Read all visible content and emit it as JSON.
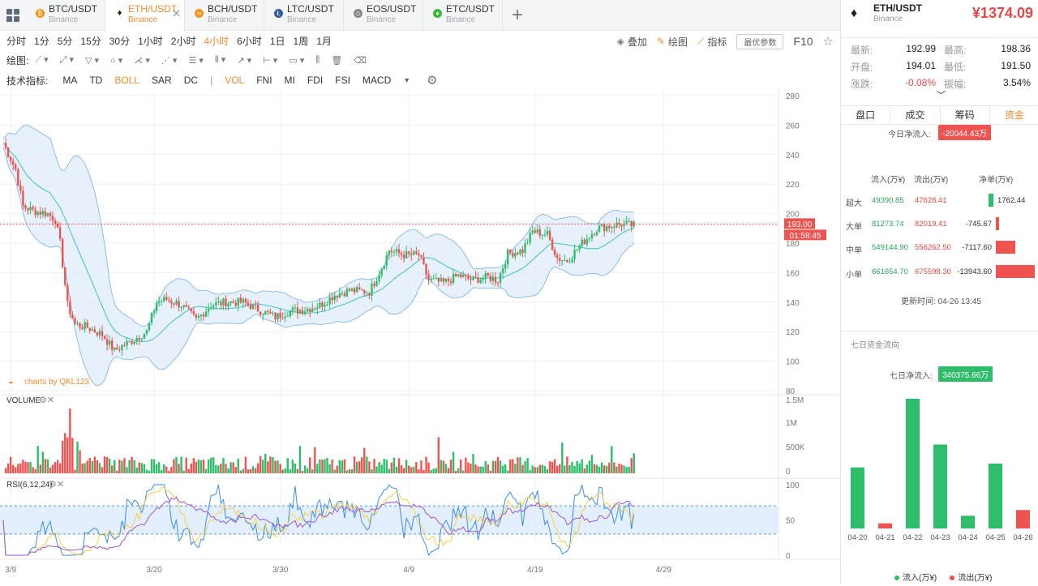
{
  "tabs": [
    {
      "pair": "BTC/USDT",
      "exchange": "Binance",
      "color": "#f7931a",
      "glyph": "₿"
    },
    {
      "pair": "ETH/USDT",
      "exchange": "Binance",
      "color": "#222222",
      "glyph": "♦",
      "active": true
    },
    {
      "pair": "BCH/USDT",
      "exchange": "Binance",
      "color": "#f7931a",
      "glyph": "∞"
    },
    {
      "pair": "LTC/USDT",
      "exchange": "Binance",
      "color": "#345d9d",
      "glyph": "Ł"
    },
    {
      "pair": "EOS/USDT",
      "exchange": "Binance",
      "color": "#888888",
      "glyph": "◇"
    },
    {
      "pair": "ETC/USDT",
      "exchange": "Binance",
      "color": "#3ab83a",
      "glyph": "♦"
    }
  ],
  "timeframes": [
    "分时",
    "1分",
    "5分",
    "15分",
    "30分",
    "1小时",
    "2小时",
    "4小时",
    "6小时",
    "1日",
    "1周",
    "1月"
  ],
  "active_timeframe": "4小时",
  "toolbar": {
    "overlay": "叠加",
    "draw": "绘图",
    "indicator": "指标",
    "pref": "最优参数",
    "f10": "F10"
  },
  "drawbar_label": "绘图:",
  "indicator_label": "技术指标:",
  "indicators_main": [
    "MA",
    "TD",
    "BOLL",
    "SAR",
    "DC"
  ],
  "indicators_sub": [
    "VOL",
    "FNI",
    "MI",
    "FDI",
    "FSI",
    "MACD"
  ],
  "indicators_on": [
    "BOLL",
    "VOL"
  ],
  "symbol": {
    "pair": "ETH/USDT",
    "exchange": "Binance",
    "price": "¥1374.09"
  },
  "stats": {
    "latest_l": "最新:",
    "latest": "192.99",
    "high_l": "最高:",
    "high": "198.36",
    "open_l": "开盘:",
    "open": "194.01",
    "low_l": "最低:",
    "low": "191.50",
    "change_l": "涨跌:",
    "change": "-0.08%",
    "amp_l": "振幅:",
    "amp": "3.54%"
  },
  "panel_tabs": [
    "盘口",
    "成交",
    "筹码",
    "资金"
  ],
  "active_panel_tab": "资金",
  "today": {
    "label": "今日净流入:",
    "value": "-20044.43万"
  },
  "flow_headers": {
    "in": "流入(万¥)",
    "out": "流出(万¥)",
    "net": "净单(万¥)"
  },
  "flows": [
    {
      "label": "超大",
      "in": "49390.85",
      "out": "47628.41",
      "net": "1762.44",
      "net_value": 1762.44
    },
    {
      "label": "大单",
      "in": "81273.74",
      "out": "82019.41",
      "net": "-745.67",
      "net_value": -745.67
    },
    {
      "label": "中单",
      "in": "549144.90",
      "out": "556262.50",
      "net": "-7117.60",
      "net_value": -7117.6
    },
    {
      "label": "小单",
      "in": "661654.70",
      "out": "675598.30",
      "net": "-13943.60",
      "net_value": -13943.6
    }
  ],
  "update_time": "更新时间: 04-26 13:45",
  "seven_day": {
    "title": "七日资金流向",
    "label": "七日净流入:",
    "value": "340375.66万"
  },
  "seven_chart": {
    "type": "bar",
    "categories": [
      "04-20",
      "04-21",
      "04-22",
      "04-23",
      "04-24",
      "04-25",
      "04-26"
    ],
    "values": [
      48000,
      4000,
      102000,
      66000,
      10000,
      51000,
      14500
    ],
    "colors": [
      "green",
      "red",
      "green",
      "green",
      "green",
      "green",
      "red"
    ],
    "legend": [
      "流入(万¥)",
      "流出(万¥)"
    ]
  },
  "colors": {
    "up": "#2ebd6b",
    "down": "#ef5350",
    "accent": "#f28b2f"
  },
  "chart_data": {
    "type": "candlestick",
    "price_ticks": [
      "280",
      "260",
      "240",
      "220",
      "200",
      "180",
      "160",
      "140",
      "120",
      "100",
      "80"
    ],
    "price_range": [
      80,
      280
    ],
    "current_price_label": "193.00",
    "countdown_label": "01:58:45",
    "volume_label": "VOLUME",
    "volume_ticks": [
      "1.5M",
      "1M",
      "500K",
      "0"
    ],
    "volume_range": [
      0,
      1500000
    ],
    "rsi_label": "RSI(6,12,24)",
    "rsi_ticks": [
      "100",
      "50",
      "0"
    ],
    "rsi_bands": [
      70,
      30
    ],
    "x_ticks": [
      {
        "label": "3/9",
        "index": 3
      },
      {
        "label": "3/20",
        "index": 61
      },
      {
        "label": "3/30",
        "index": 112
      },
      {
        "label": "4/9",
        "index": 164
      },
      {
        "label": "4/19",
        "index": 215
      },
      {
        "label": "4/29",
        "index": 267
      }
    ],
    "closes": [
      {
        "i": 0,
        "v": 248
      },
      {
        "i": 5,
        "v": 230
      },
      {
        "i": 8,
        "v": 205
      },
      {
        "i": 12,
        "v": 202
      },
      {
        "i": 18,
        "v": 200
      },
      {
        "i": 21,
        "v": 196
      },
      {
        "i": 23,
        "v": 180
      },
      {
        "i": 26,
        "v": 138
      },
      {
        "i": 29,
        "v": 125
      },
      {
        "i": 34,
        "v": 123
      },
      {
        "i": 40,
        "v": 118
      },
      {
        "i": 45,
        "v": 107
      },
      {
        "i": 52,
        "v": 114
      },
      {
        "i": 58,
        "v": 120
      },
      {
        "i": 62,
        "v": 140
      },
      {
        "i": 66,
        "v": 142
      },
      {
        "i": 72,
        "v": 138
      },
      {
        "i": 78,
        "v": 128
      },
      {
        "i": 84,
        "v": 138
      },
      {
        "i": 90,
        "v": 140
      },
      {
        "i": 97,
        "v": 140
      },
      {
        "i": 103,
        "v": 135
      },
      {
        "i": 110,
        "v": 130
      },
      {
        "i": 116,
        "v": 134
      },
      {
        "i": 122,
        "v": 135
      },
      {
        "i": 128,
        "v": 138
      },
      {
        "i": 134,
        "v": 145
      },
      {
        "i": 140,
        "v": 148
      },
      {
        "i": 148,
        "v": 147
      },
      {
        "i": 152,
        "v": 160
      },
      {
        "i": 156,
        "v": 175
      },
      {
        "i": 162,
        "v": 172
      },
      {
        "i": 168,
        "v": 172
      },
      {
        "i": 172,
        "v": 155
      },
      {
        "i": 178,
        "v": 153
      },
      {
        "i": 184,
        "v": 158
      },
      {
        "i": 190,
        "v": 155
      },
      {
        "i": 196,
        "v": 157
      },
      {
        "i": 200,
        "v": 155
      },
      {
        "i": 204,
        "v": 173
      },
      {
        "i": 210,
        "v": 175
      },
      {
        "i": 214,
        "v": 188
      },
      {
        "i": 220,
        "v": 186
      },
      {
        "i": 224,
        "v": 170
      },
      {
        "i": 228,
        "v": 168
      },
      {
        "i": 234,
        "v": 180
      },
      {
        "i": 240,
        "v": 190
      },
      {
        "i": 246,
        "v": 192
      },
      {
        "i": 250,
        "v": 193
      }
    ]
  },
  "watermark": "charts by QKL123"
}
